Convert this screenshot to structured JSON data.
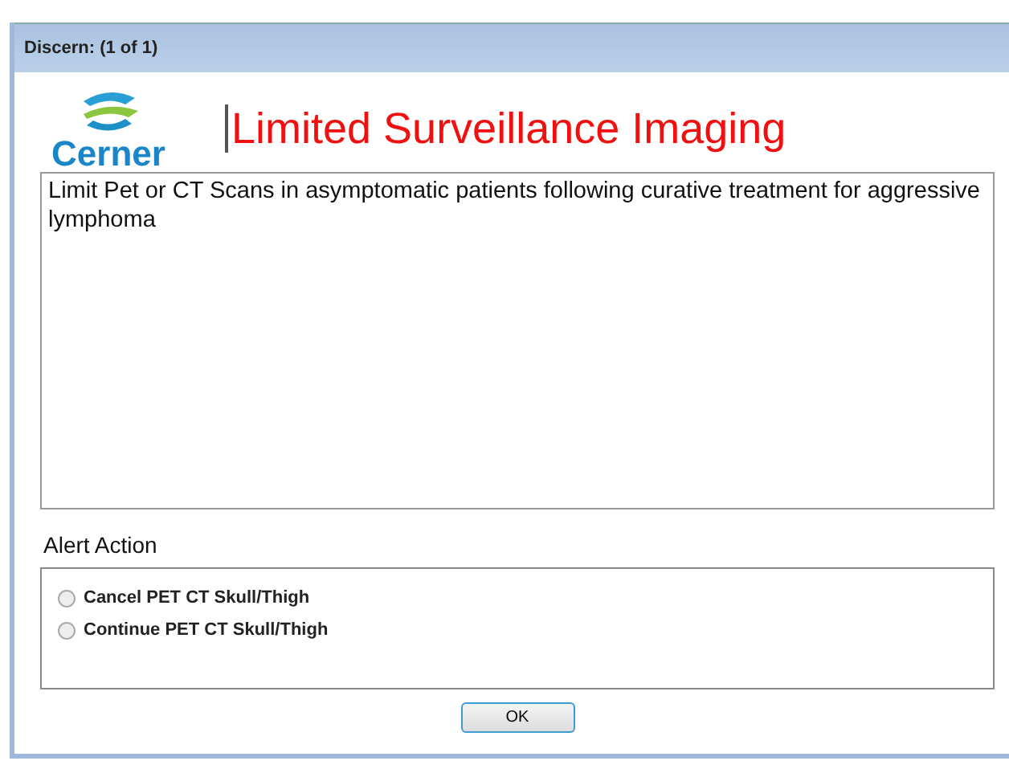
{
  "window": {
    "title": "Discern:  (1 of 1)"
  },
  "logo": {
    "text": "Cerner"
  },
  "alert_title": "Limited Surveillance Imaging",
  "message": "Limit Pet or CT Scans in asymptomatic patients following curative treatment for aggressive lymphoma",
  "alert_action": {
    "label": "Alert Action",
    "options": [
      {
        "label": "Cancel PET CT Skull/Thigh",
        "selected": false
      },
      {
        "label": "Continue PET CT Skull/Thigh",
        "selected": false
      }
    ]
  },
  "buttons": [
    "OK"
  ]
}
